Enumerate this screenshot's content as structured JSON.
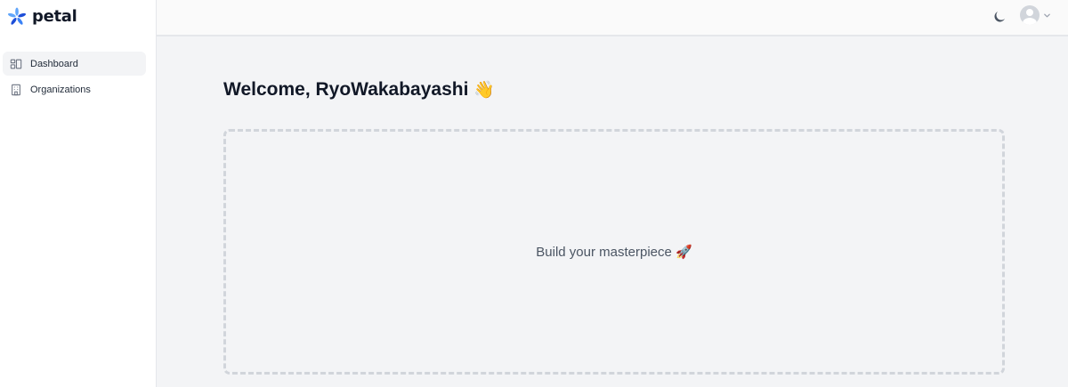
{
  "app": {
    "logo_text": "petal",
    "brand_colors": [
      "#1d4ed8",
      "#60a5fa"
    ]
  },
  "sidebar": {
    "items": [
      {
        "label": "Dashboard",
        "icon": "dashboard-icon",
        "active": true
      },
      {
        "label": "Organizations",
        "icon": "building-icon",
        "active": false
      }
    ]
  },
  "topbar": {
    "theme_icon": "moon-icon",
    "avatar_icon": "user-avatar-icon",
    "menu_icon": "chevron-down-icon"
  },
  "main": {
    "welcome": "Welcome, RyoWakabayashi",
    "welcome_emoji": "👋",
    "placeholder": "Build your masterpiece 🚀"
  }
}
